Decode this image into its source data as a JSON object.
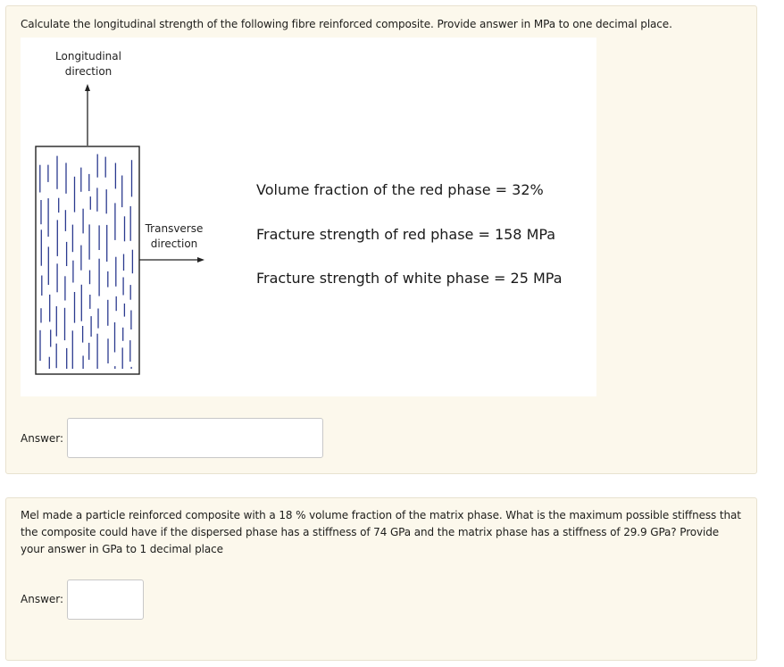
{
  "question1": {
    "text": "Calculate the longitudinal strength of the following fibre reinforced composite. Provide answer in MPa to one decimal place.",
    "figure": {
      "longitudinal_label": "Longitudinal\ndirection",
      "transverse_label": "Transverse\ndirection",
      "statements": [
        "Volume fraction of the red phase = 32%",
        "Fracture strength of red phase = 158 MPa",
        "Fracture strength of white phase =  25 MPa"
      ]
    },
    "answer_label": "Answer:",
    "answer_value": ""
  },
  "question2": {
    "text": "Mel made a particle reinforced composite with a 18 % volume fraction of the matrix phase. What is the maximum possible stiffness that the composite could have if the dispersed phase has a stiffness of 74 GPa and the matrix phase has a stiffness of 29.9 GPa? Provide your answer in GPa  to 1 decimal place",
    "answer_label": "Answer:",
    "answer_value": ""
  },
  "colors": {
    "card_background": "#fcf8ec",
    "fibre_color": "#2b3a8f"
  }
}
